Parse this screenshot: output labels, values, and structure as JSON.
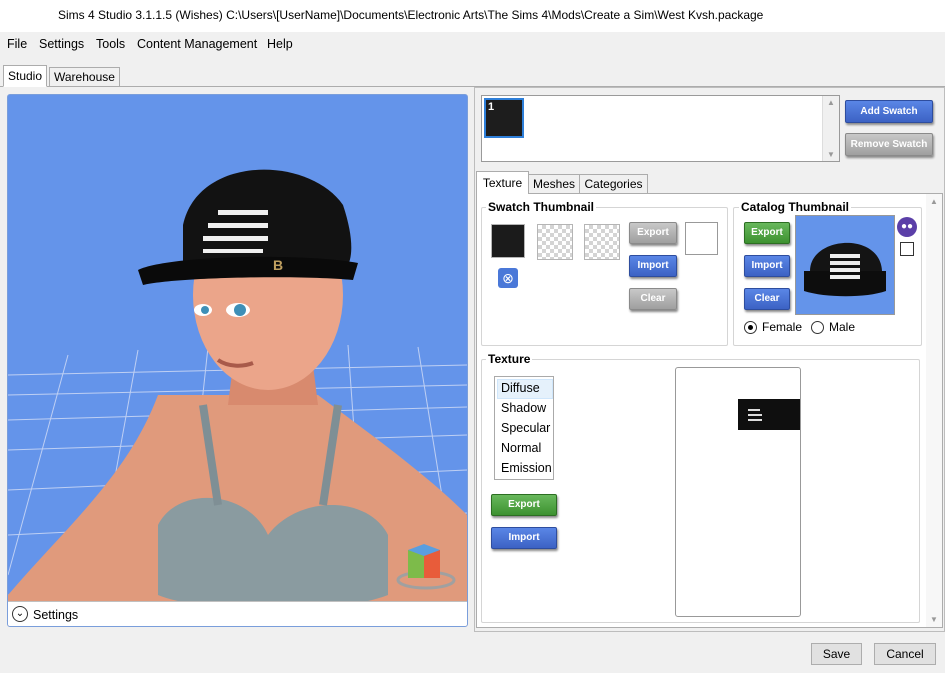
{
  "window": {
    "title": "Sims 4 Studio 3.1.1.5 (Wishes)  C:\\Users\\[UserName]\\Documents\\Electronic Arts\\The Sims 4\\Mods\\Create a Sim\\West Kvsh.package"
  },
  "menu": [
    "File",
    "Settings",
    "Tools",
    "Content Management",
    "Help"
  ],
  "main_tabs": [
    {
      "label": "Studio",
      "active": true
    },
    {
      "label": "Warehouse",
      "active": false
    }
  ],
  "viewport": {
    "settings_label": "Settings",
    "background": "#6494ea"
  },
  "swatches": {
    "items": [
      {
        "label": "1",
        "color": "#1d1d1d"
      }
    ],
    "add_label": "Add Swatch",
    "remove_label": "Remove Swatch"
  },
  "sub_tabs": [
    {
      "label": "Texture",
      "active": true
    },
    {
      "label": "Meshes",
      "active": false
    },
    {
      "label": "Categories",
      "active": false
    }
  ],
  "swatch_thumbnail": {
    "title": "Swatch Thumbnail",
    "export_label": "Export",
    "import_label": "Import",
    "clear_label": "Clear"
  },
  "catalog_thumbnail": {
    "title": "Catalog Thumbnail",
    "export_label": "Export",
    "import_label": "Import",
    "clear_label": "Clear",
    "gender_options": [
      "Female",
      "Male"
    ],
    "selected_gender": "Female"
  },
  "texture": {
    "title": "Texture",
    "items": [
      "Diffuse",
      "Shadow",
      "Specular",
      "Normal",
      "Emission"
    ],
    "selected": "Diffuse",
    "export_label": "Export",
    "import_label": "Import"
  },
  "footer": {
    "save_label": "Save",
    "cancel_label": "Cancel"
  },
  "colors": {
    "blue_button": "#3c62c4",
    "green_button": "#3d9130",
    "gray_button": "#9f9f9f",
    "accent_border": "#7a9edb"
  }
}
